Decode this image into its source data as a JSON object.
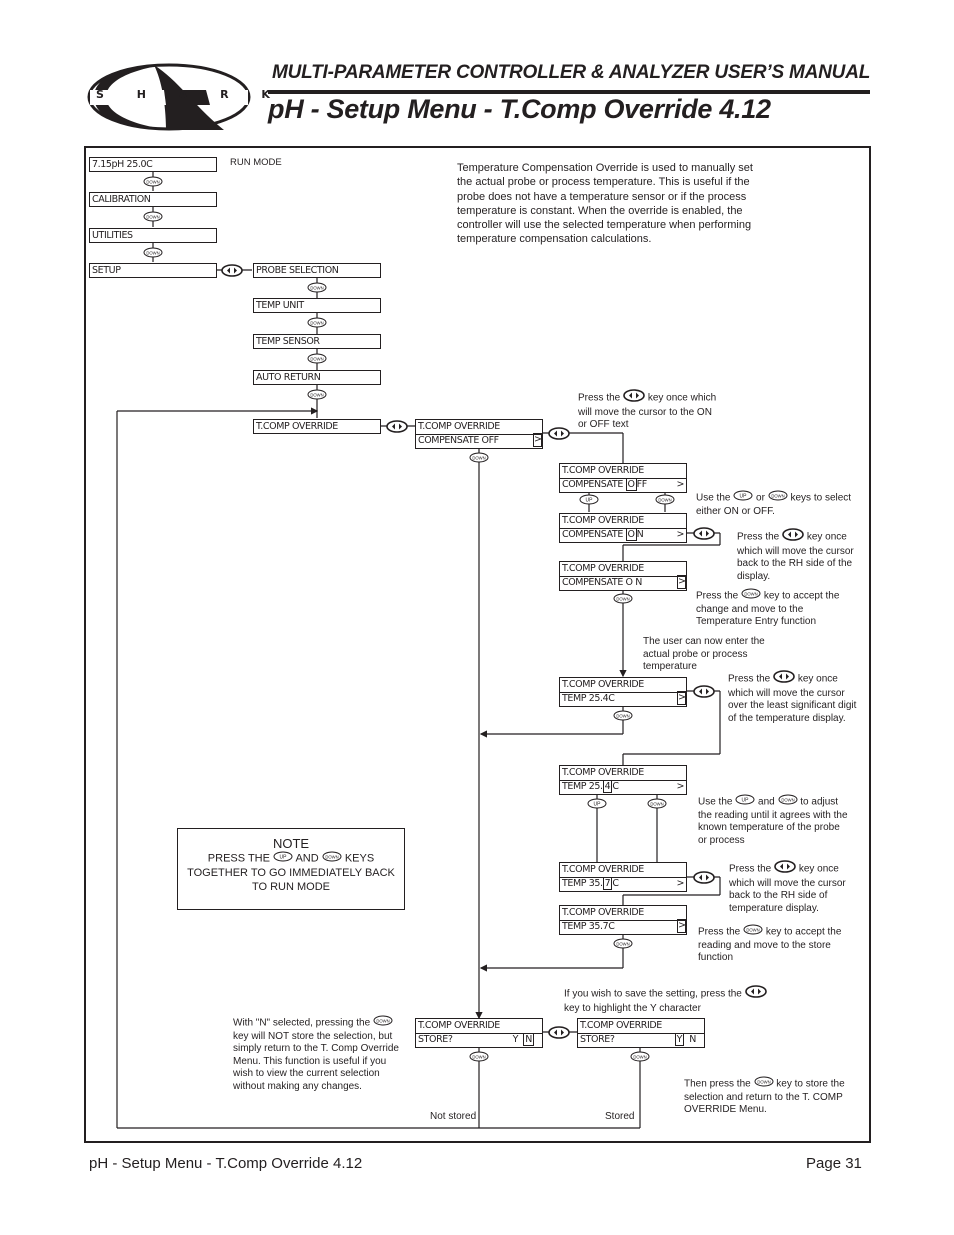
{
  "header": {
    "logo_text": "S H A R K",
    "manual_title": "MULTI-PARAMETER CONTROLLER & ANALYZER USER’S MANUAL",
    "page_title": "pH - Setup Menu - T.Comp Override 4.12"
  },
  "keys": {
    "down": "DOWN",
    "up": "UP",
    "left_right": "left-right-arrow-key"
  },
  "main_menu": {
    "run_display": "7.15pH   25.0C",
    "run_label": "RUN MODE",
    "items": [
      "CALIBRATION",
      "UTILITIES",
      "SETUP"
    ]
  },
  "setup_menu": {
    "items": [
      "PROBE SELECTION",
      "TEMP UNIT",
      "TEMP SENSOR",
      "AUTO RETURN",
      "T.COMP OVERRIDE"
    ]
  },
  "description": "Temperature Compensation Override is used to manually set the actual probe or process temperature. This is useful if the probe does not have a temperature sensor or if the process temperature is constant. When the override is enabled, the controller will use the selected temperature when performing temperature compensation calculations.",
  "screens": {
    "title": "T.COMP OVERRIDE",
    "s1": {
      "line2": "COMPENSATE OFF",
      "arrow": ">"
    },
    "s2": {
      "prefix": "COMPENSATE ",
      "cursor": "O",
      "suffix": "FF",
      "arrow": ">"
    },
    "s3": {
      "prefix": "COMPENSATE ",
      "cursor": "O",
      "suffix": "N",
      "arrow": ">"
    },
    "s4": {
      "line2": "COMPENSATE  O N",
      "arrow": ">"
    },
    "s5": {
      "line2": "TEMP    25.4C",
      "arrow": ">"
    },
    "s6": {
      "prefix": "TEMP    25.",
      "cursor": "4",
      "suffix": "C",
      "arrow": ">"
    },
    "s7": {
      "prefix": "TEMP    35.",
      "cursor": "7",
      "suffix": "C",
      "arrow": ">"
    },
    "s8": {
      "line2": "TEMP    35.7C",
      "arrow": ">"
    },
    "s9": {
      "line2": "STORE?",
      "y": "Y",
      "n": "N"
    },
    "s10": {
      "line2": "STORE?",
      "y": "Y",
      "n": "N"
    }
  },
  "annotations": {
    "a1": {
      "pre": "Press the",
      "post": "key once which will move the cursor to the ON or OFF text"
    },
    "a2": {
      "pre": "Use the",
      "mid": "or",
      "post": "keys to select either ON or OFF."
    },
    "a3": {
      "pre": "Press the",
      "post": "key once which will move the cursor back to the RH side of the display."
    },
    "a4": {
      "pre": "Press the",
      "post": "key to accept the change and move to the Temperature Entry function"
    },
    "a5": "The user can now enter the actual probe or process temperature",
    "a6": {
      "pre": "Press the",
      "post": "key once which will move the cursor over the least significant digit of the temperature display."
    },
    "a7": {
      "pre": "Use the",
      "mid": "and",
      "post": "to adjust the reading until it agrees with the known temperature of the probe or process"
    },
    "a8": {
      "pre": "Press the",
      "post": "key once which will move the cursor back to the RH side of temperature display."
    },
    "a9": {
      "pre": "Press the",
      "post": "key to accept the reading and move to the store function"
    },
    "a10": {
      "pre": "If you wish to save the setting, press the",
      "post": "key to highlight the Y character"
    },
    "a11": {
      "pre": "With \"N\" selected, pressing the",
      "post": "key will NOT store the selection, but simply return to the T. Comp Override Menu. This function is useful if you wish to view the current selection without making any changes."
    },
    "a12": {
      "pre": "Then press the",
      "post": "key to store the selection and return to the T. COMP OVERRIDE Menu."
    },
    "not_stored": "Not stored",
    "stored": "Stored"
  },
  "note": {
    "title": "NOTE",
    "pre": "PRESS THE",
    "mid": "AND",
    "post": "KEYS TOGETHER TO GO IMMEDIATELY BACK TO RUN MODE"
  },
  "footer": {
    "left": "pH - Setup Menu - T.Comp Override 4.12",
    "right": "Page 31"
  }
}
